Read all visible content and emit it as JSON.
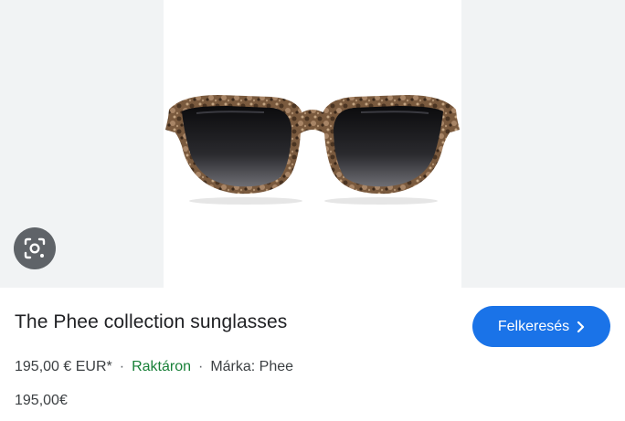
{
  "product": {
    "title": "The Phee collection sunglasses",
    "price_with_currency": "195,00 € EUR*",
    "separator": "·",
    "stock_status": "Raktáron",
    "brand": "Márka: Phee",
    "price_plain": "195,00€",
    "image_icon": "sunglasses-product-image"
  },
  "actions": {
    "visit_label": "Felkeresés",
    "visit_icon": "chevron-right-icon",
    "lens_icon": "google-lens-icon"
  },
  "colors": {
    "accent": "#1a73e8",
    "stock": "#188038",
    "panel_bg": "#f1f3f4",
    "lens_bg": "#5f6368"
  }
}
